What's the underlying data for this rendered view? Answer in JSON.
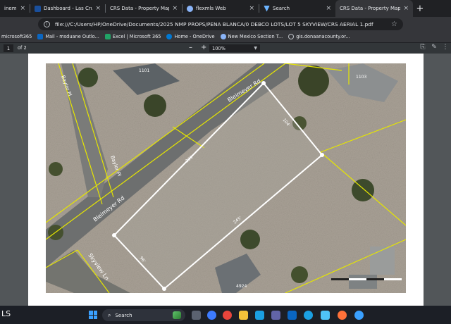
{
  "browser": {
    "tabs": [
      {
        "label": "inem - Outlook",
        "active": false,
        "color": "#0a66c2"
      },
      {
        "label": "Dashboard - Las Cruces Area",
        "active": false,
        "color": "#1a4f9c"
      },
      {
        "label": "CRS Data - Property Map for - C",
        "active": false,
        "color": "#2f5d8a"
      },
      {
        "label": "flexmls Web",
        "active": false,
        "color": "#8ab4f8"
      },
      {
        "label": "Search",
        "active": false,
        "color": "#6cb4ff"
      },
      {
        "label": "CRS Data - Property Map for - C",
        "active": true,
        "color": "#2f5d8a"
      }
    ],
    "new_tab": "+",
    "address": "file:///C:/Users/HP/OneDrive/Documents/2025 NMP PROPS/PENA BLANCA/0 DEBCO LOTS/LOT 5 SKYVIEW/CRS AERIAL 1.pdf",
    "bookmarks": [
      {
        "label": "microsoft365",
        "color": "#e8eaed"
      },
      {
        "label": "Mail - msduane Outlo...",
        "color": "#0a66c2"
      },
      {
        "label": "Excel | Microsoft 365",
        "color": "#21a366"
      },
      {
        "label": "Home - OneDrive",
        "color": "#0078d4"
      },
      {
        "label": "New Mexico Section T...",
        "color": "#8ab4f8"
      },
      {
        "label": "gis.donaanacounty.or...",
        "color": "#bdc1c6"
      }
    ]
  },
  "pdf": {
    "page_current": "1",
    "page_total": "of 2",
    "zoom_minus": "–",
    "zoom_plus": "+",
    "zoom": "100%"
  },
  "map": {
    "streets": {
      "bleimeyer_upper": "Bleimeyer Rd",
      "bleimeyer_lower": "Bleimeyer Rd",
      "baylor_upper": "Baylor Pl",
      "baylor_lower": "Baylor Pl",
      "skyview": "Skyview Ln"
    },
    "addresses": {
      "top_left": "1101",
      "top_right": "1103",
      "bottom": "4924"
    },
    "dimensions": {
      "top": "239'",
      "right": "104'",
      "bottom": "245'",
      "left": "96'"
    },
    "colors": {
      "parcel_outline": "#ffffff",
      "parcel_lines": "#e6e600",
      "road": "#6d6f6f"
    }
  },
  "taskbar": {
    "left_text": "LS",
    "search_placeholder": "Search",
    "apps": [
      {
        "name": "task-view-icon",
        "color": "#5b6270"
      },
      {
        "name": "chrome-icon",
        "color": "#e8453c"
      },
      {
        "name": "file-explorer-icon",
        "color": "#f3c13a"
      },
      {
        "name": "edge-icon",
        "color": "#1ba0e2"
      },
      {
        "name": "store-icon",
        "color": "#3d7bff"
      },
      {
        "name": "teams-icon",
        "color": "#6264a7"
      },
      {
        "name": "outlook-icon",
        "color": "#0a66c2"
      },
      {
        "name": "copilot-icon",
        "color": "#4fc3f7"
      },
      {
        "name": "firefox-icon",
        "color": "#ff7139"
      },
      {
        "name": "app-icon",
        "color": "#3aa0ff"
      }
    ]
  }
}
